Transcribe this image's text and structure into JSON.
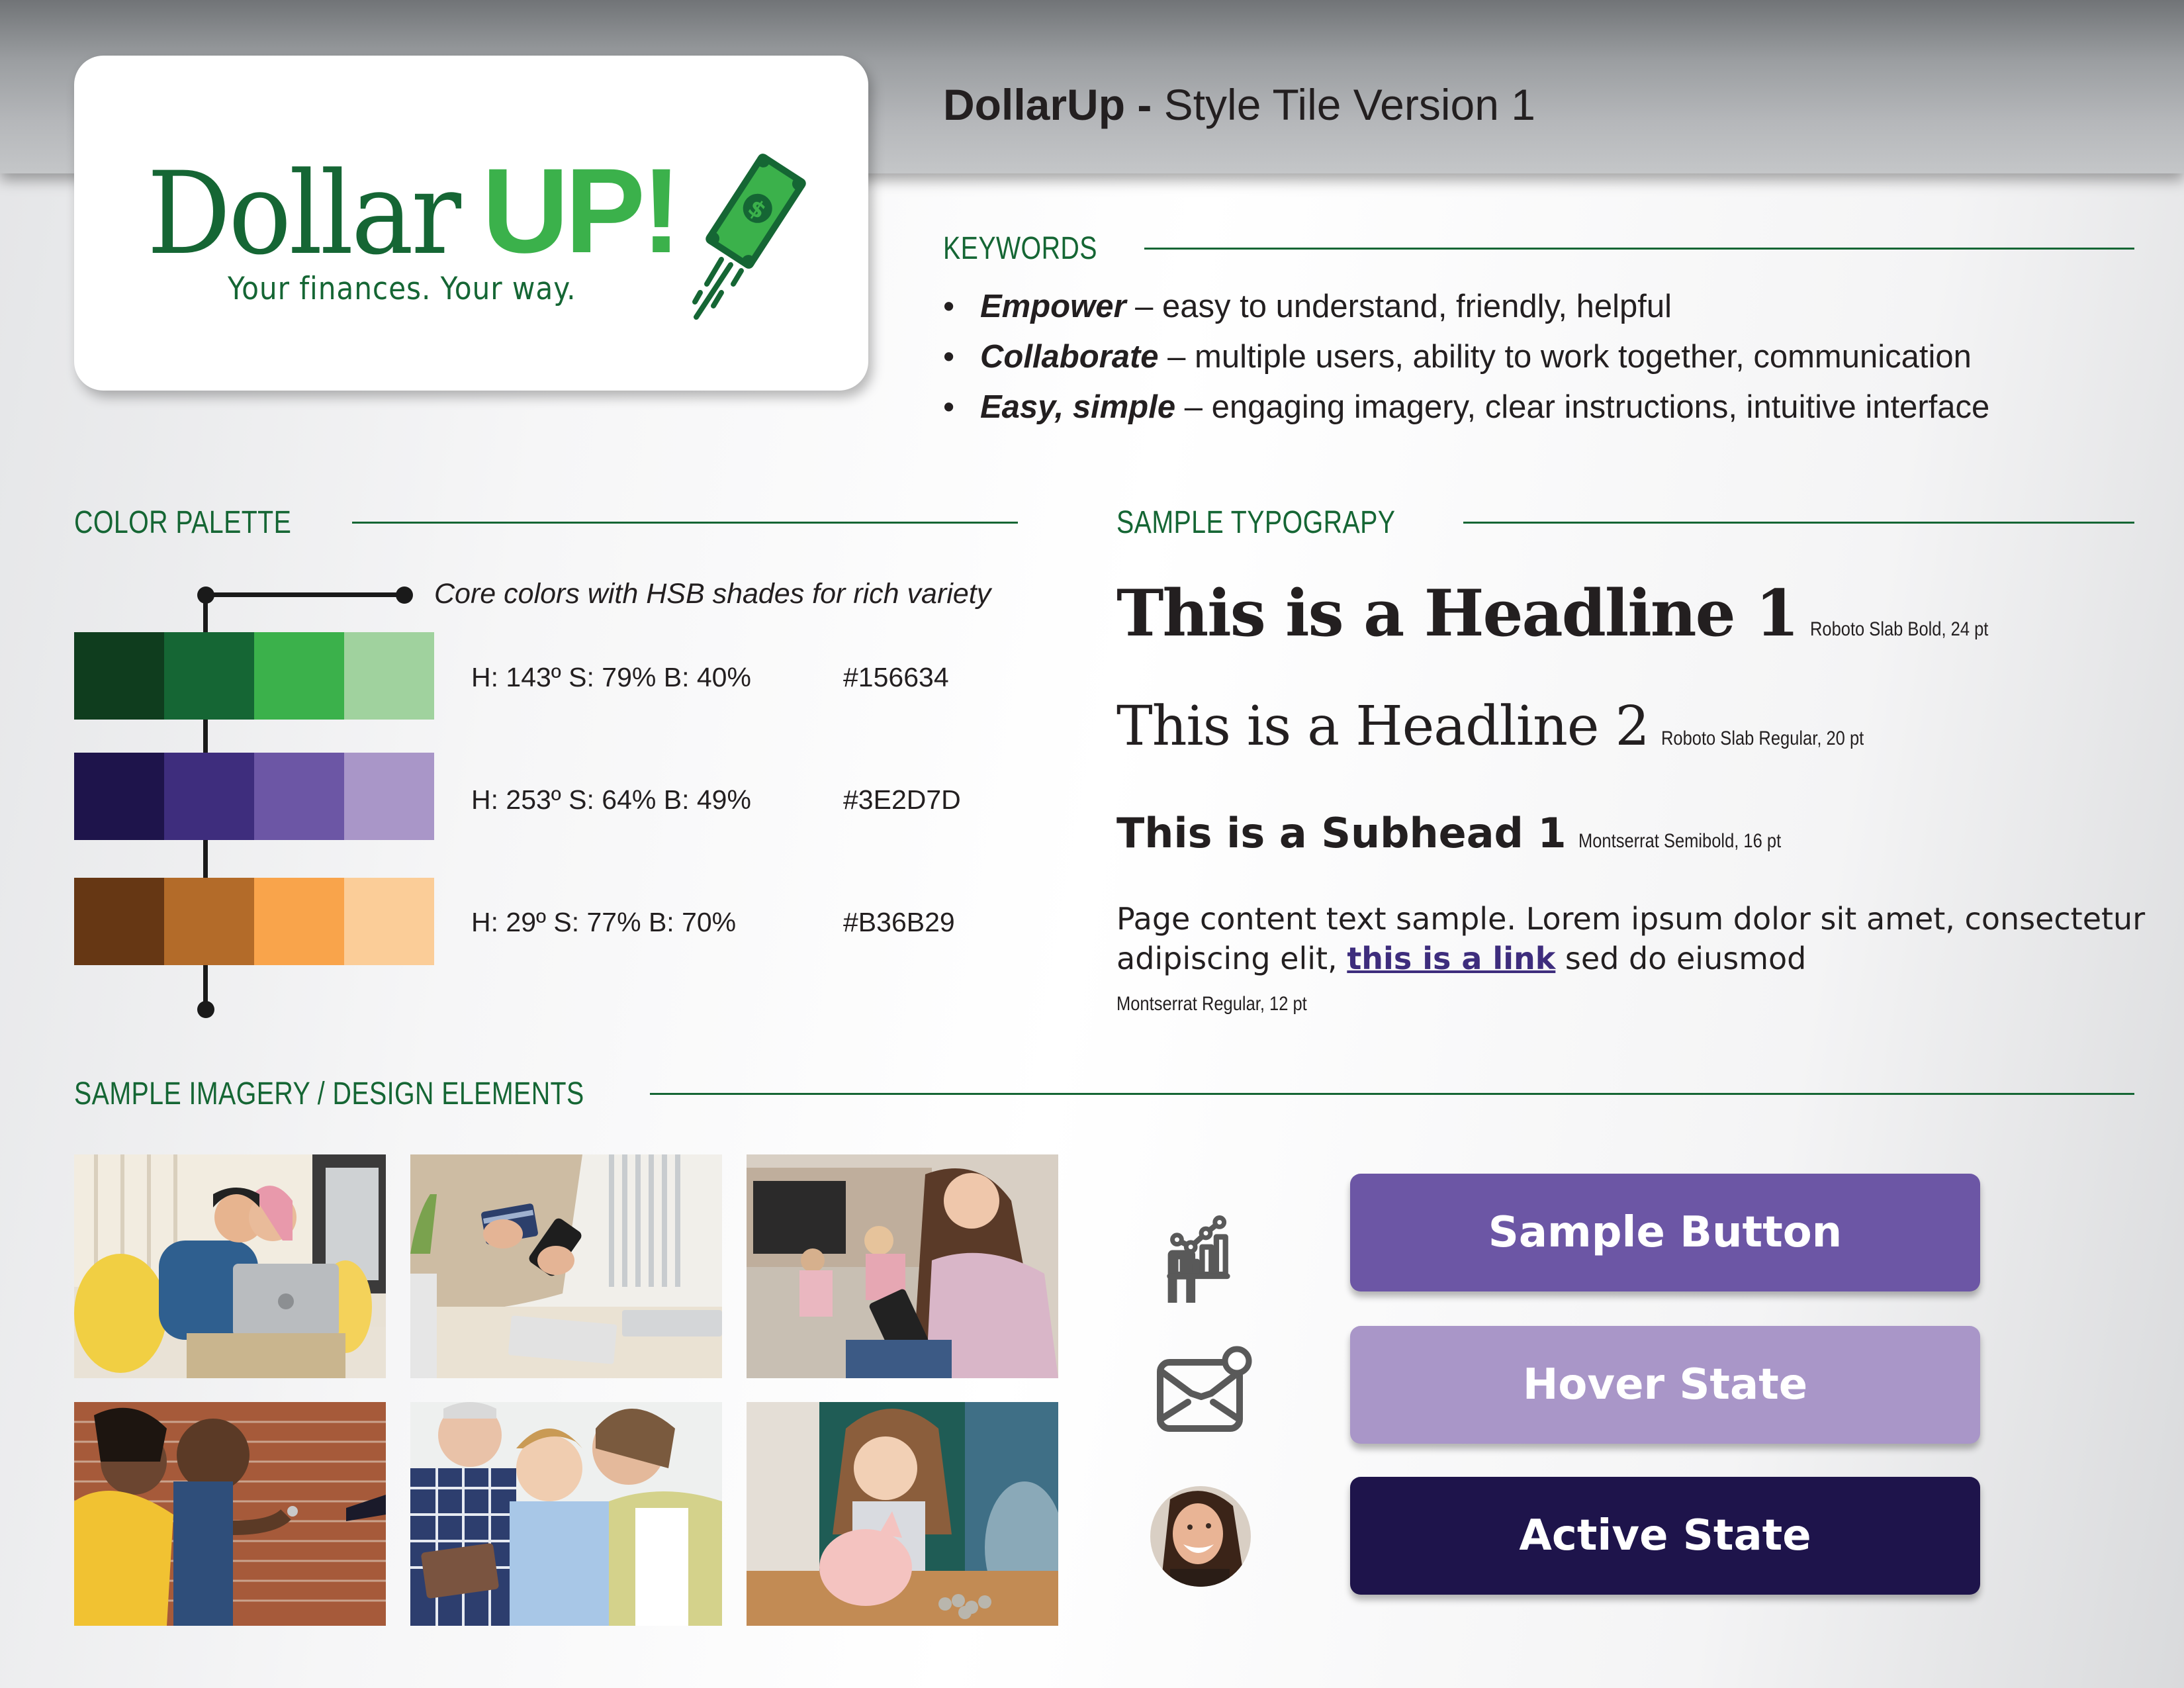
{
  "header": {
    "title_bold": "DollarUp -",
    "title_rest": " Style Tile Version 1"
  },
  "logo": {
    "word_dollar": "Dollar",
    "word_up": "UP!",
    "tagline": "Your finances. Your way.",
    "bill_icon": "flying-dollar-bill-icon",
    "colors": {
      "dark": "#156634",
      "bright": "#3bb14b"
    }
  },
  "keywords": {
    "heading": "KEYWORDS",
    "items": [
      {
        "term": "Empower",
        "dash": " – ",
        "desc": "easy to understand, friendly, helpful"
      },
      {
        "term": "Collaborate",
        "dash": " – ",
        "desc": "multiple users, ability to work together, communication"
      },
      {
        "term": "Easy, simple",
        "dash": " – ",
        "desc": "engaging imagery, clear instructions, intuitive interface"
      }
    ]
  },
  "palette": {
    "heading": "COLOR PALETTE",
    "caption": "Core colors with HSB shades for rich variety",
    "rows": [
      {
        "hsb": "H: 143º  S: 79%  B: 40%",
        "hex": "#156634",
        "shades": [
          "#0f3d1e",
          "#156634",
          "#3bb14b",
          "#a0d29e"
        ]
      },
      {
        "hsb": "H: 253º  S: 64%  B: 49%",
        "hex": "#3E2D7D",
        "shades": [
          "#1e144b",
          "#3e2d7d",
          "#6c56a5",
          "#a996c8"
        ]
      },
      {
        "hsb": "H: 29º  S: 77%  B: 70%",
        "hex": "#B36B29",
        "shades": [
          "#663714",
          "#b36b29",
          "#f9a44b",
          "#fbcd98"
        ]
      }
    ]
  },
  "typography": {
    "heading": "SAMPLE TYPOGRAPY",
    "h1": {
      "text": "This is a Headline 1",
      "note": "Roboto Slab Bold, 24 pt"
    },
    "h2": {
      "text": "This is a Headline 2",
      "note": "Roboto Slab Regular, 20 pt"
    },
    "subhead": {
      "text": "This is a Subhead 1",
      "note": "Montserrat Semibold, 16 pt"
    },
    "body": {
      "before_link": "Page content text sample. Lorem ipsum dolor sit amet, consectetur adipiscing elit, ",
      "link": "this is a link",
      "after_link": " sed do eiusmod",
      "note": "Montserrat Regular, 12 pt",
      "link_color": "#3e2d7d"
    }
  },
  "imagery": {
    "heading": "SAMPLE IMAGERY / DESIGN ELEMENTS",
    "photos": [
      {
        "name": "photo-couple-laptop",
        "alt": "Couple on sofa with laptop"
      },
      {
        "name": "photo-card-phone",
        "alt": "Person holding credit card and phone"
      },
      {
        "name": "photo-mother-tablet",
        "alt": "Mother using tablet with kids in background"
      },
      {
        "name": "photo-couple-keys",
        "alt": "Couple receiving house keys"
      },
      {
        "name": "photo-grandparents-tablet",
        "alt": "Grandparents and boy with tablet"
      },
      {
        "name": "photo-girl-piggybank",
        "alt": "Girl putting coin in piggy bank"
      }
    ],
    "icons": [
      "bar-chart-growth-icon",
      "mail-notification-icon",
      "user-avatar"
    ],
    "buttons": [
      {
        "label": "Sample Button",
        "state": "default",
        "color": "#6c56a5"
      },
      {
        "label": "Hover State",
        "state": "hover",
        "color": "#a996c8"
      },
      {
        "label": "Active State",
        "state": "active",
        "color": "#1e144b"
      }
    ]
  }
}
